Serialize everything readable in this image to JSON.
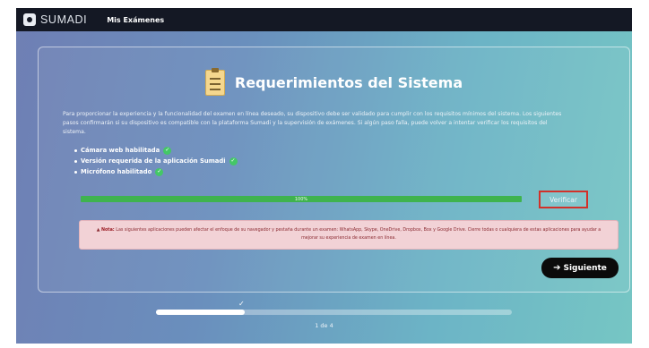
{
  "header": {
    "logo_text": "SUMADI",
    "nav_link": "Mis Exámenes"
  },
  "card": {
    "title": "Requerimientos del Sistema",
    "title_icon": "clipboard-icon",
    "intro": "Para proporcionar la experiencia y la funcionalidad del examen en línea deseado, su dispositivo debe ser validado para cumplir con los requisitos mínimos del sistema. Los siguientes pasos confirmarán si su dispositivo es compatible con la plataforma Sumadi y la supervisión de exámenes. Si algún paso falla, puede volver a intentar verificar los requisitos del sistema.",
    "requirements": [
      {
        "label": "Cámara web habilitada",
        "status_icon": "check-circle-icon"
      },
      {
        "label": "Versión requerida de la aplicación Sumadi",
        "status_icon": "check-circle-icon"
      },
      {
        "label": "Micrófono habilitado",
        "status_icon": "check-circle-icon"
      }
    ],
    "progress": {
      "label": "100%",
      "percent": 100,
      "color": "#3fb34e"
    },
    "verify_button": "Verificar",
    "note": {
      "label": "Nota:",
      "text": "Las siguientes aplicaciones pueden afectar el enfoque de su navegador y pestaña durante un examen: WhatsApp, Skype, OneDrive, Dropbox, Box y Google Drive. Cierre todas o cualquiera de estas aplicaciones para ayudar a mejorar su experiencia de examen en línea."
    },
    "next_button": "Siguiente"
  },
  "stepper": {
    "text": "1 de 4",
    "fraction": 0.25
  },
  "colors": {
    "accent_green": "#3fb34e",
    "verify_border": "#d2312a",
    "note_bg": "#f2d2d6",
    "topbar": "#141824"
  }
}
